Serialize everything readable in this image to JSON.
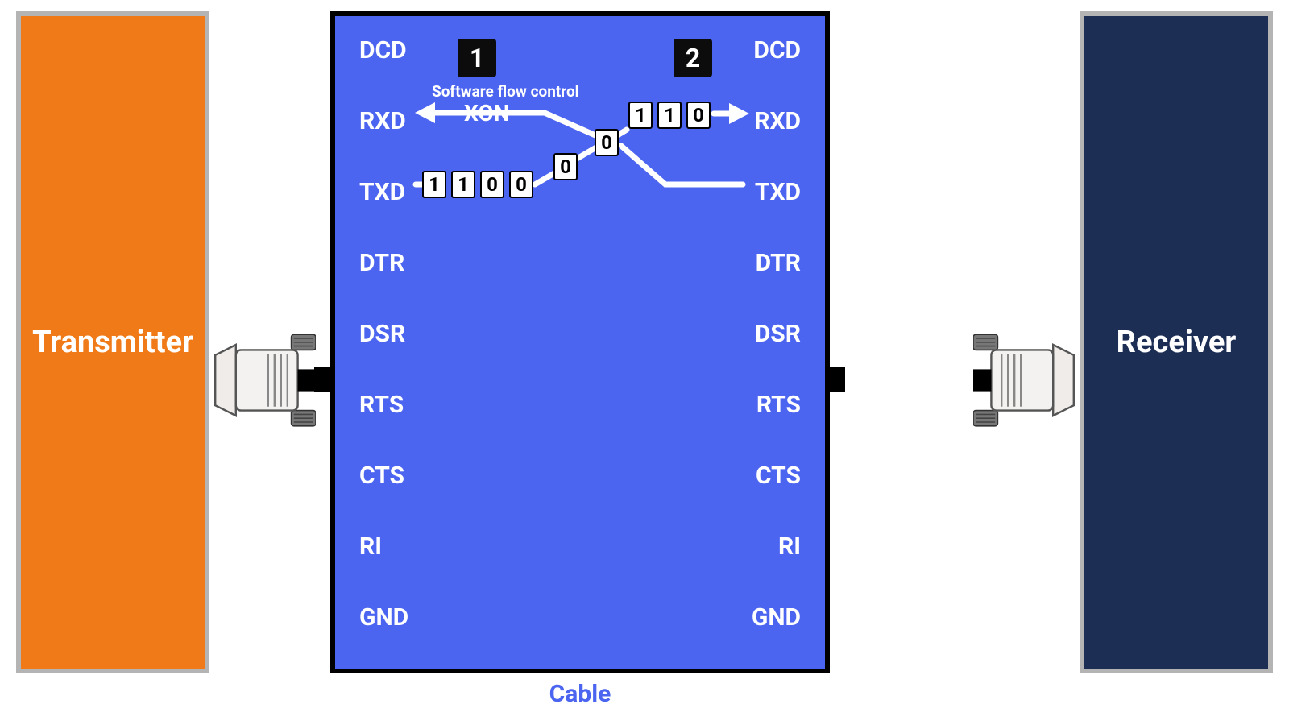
{
  "left_box": {
    "label": "Transmitter"
  },
  "right_box": {
    "label": "Receiver"
  },
  "cable": {
    "label": "Cable"
  },
  "side_numbers": {
    "one": "1",
    "two": "2"
  },
  "sfc_text": "Software flow control",
  "xon_text": "XON",
  "pins_left": [
    "DCD",
    "RXD",
    "TXD",
    "DTR",
    "DSR",
    "RTS",
    "CTS",
    "RI",
    "GND"
  ],
  "pins_right": [
    "DCD",
    "RXD",
    "TXD",
    "DTR",
    "DSR",
    "RTS",
    "CTS",
    "RI",
    "GND"
  ],
  "bits_txd": [
    "1",
    "1",
    "0",
    "0"
  ],
  "bits_cross_lo": [
    "0"
  ],
  "bits_cross_hi": [
    "0"
  ],
  "bits_rxd": [
    "1",
    "1",
    "0"
  ]
}
